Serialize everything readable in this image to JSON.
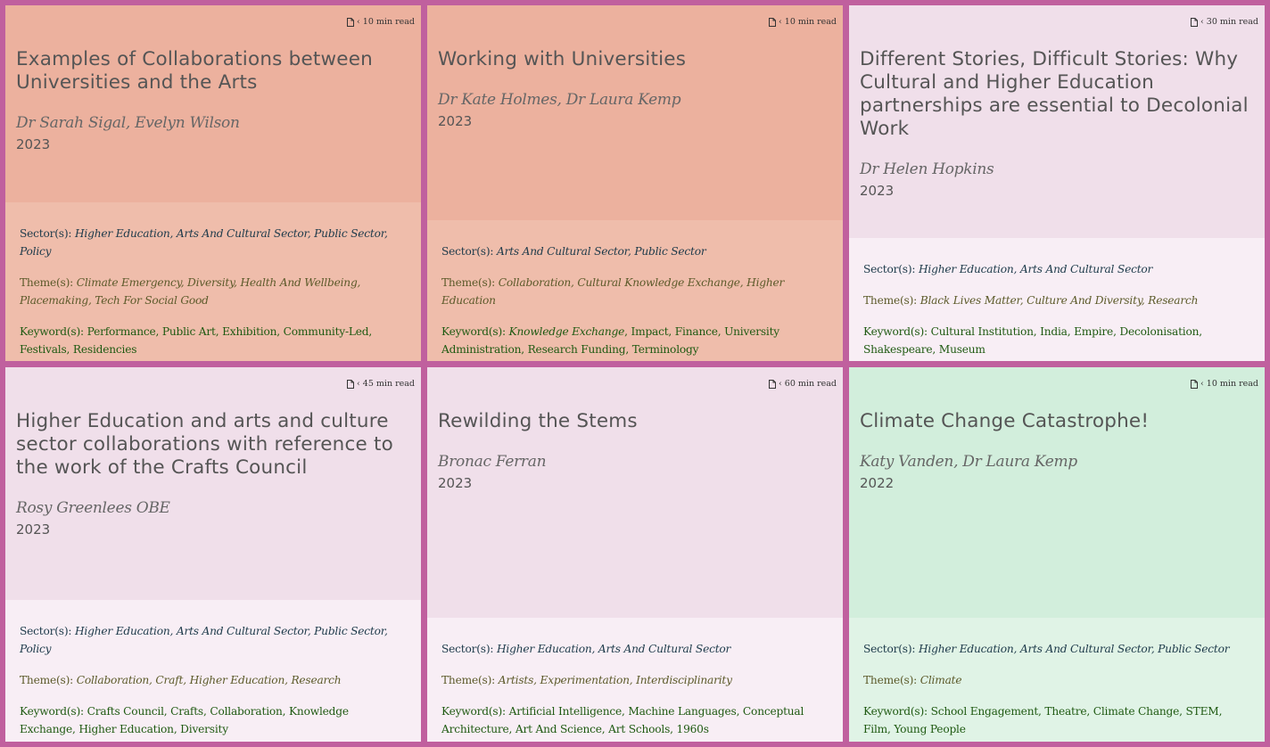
{
  "labels": {
    "sector": "Sector(s): ",
    "theme": "Theme(s): ",
    "keyword": "Keyword(s): "
  },
  "colors": {
    "frame": "#c0609e",
    "salmon_top": "#ecb19e",
    "salmon_bottom": "#efbdab",
    "lilac_top": "#f0dfea",
    "lilac_bottom": "#f8eef5",
    "mint_top": "#d2eedc",
    "mint_bottom": "#e0f3e6"
  },
  "cards": [
    {
      "read_time": "‹ 10 min read",
      "title": "Examples of Collaborations between Universities and the Arts",
      "authors": "Dr Sarah Sigal, Evelyn Wilson",
      "year": "2023",
      "sectors": "Higher Education, Arts And Cultural Sector, Public Sector, Policy",
      "themes": "Climate Emergency, Diversity, Health And Wellbeing, Placemaking, Tech For Social Good",
      "keywords": "Performance, Public Art, Exhibition, Community-Led, Festivals, Residencies"
    },
    {
      "read_time": "‹ 10 min read",
      "title": "Working with Universities",
      "authors": "Dr Kate Holmes, Dr Laura Kemp",
      "year": "2023",
      "sectors": "Arts And Cultural Sector, Public Sector",
      "themes": "Collaboration, Cultural Knowledge Exchange, Higher Education",
      "keywords_italic": "Knowledge Exchange",
      "keywords": ", Impact, Finance, University Administration, Research Funding, Terminology"
    },
    {
      "read_time": "‹ 30 min read",
      "title": "Different Stories, Difficult Stories: Why Cultural and Higher Education partnerships are essential to Decolonial Work",
      "authors": "Dr Helen Hopkins",
      "year": "2023",
      "sectors": "Higher Education, Arts And Cultural Sector",
      "themes": "Black Lives Matter, Culture And Diversity, Research",
      "keywords": "Cultural Institution, India, Empire, Decolonisation, Shakespeare, Museum"
    },
    {
      "read_time": "‹ 45 min read",
      "title": "Higher Education and arts and culture sector collaborations with reference to the work of the Crafts Council",
      "authors": "Rosy Greenlees OBE",
      "year": "2023",
      "sectors": "Higher Education, Arts And Cultural Sector, Public Sector, Policy",
      "themes": "Collaboration, Craft, Higher Education, Research",
      "keywords": "Crafts Council, Crafts, Collaboration, Knowledge Exchange, Higher Education, Diversity"
    },
    {
      "read_time": "‹ 60 min read",
      "title": "Rewilding the Stems",
      "authors": "Bronac Ferran",
      "year": "2023",
      "sectors": "Higher Education, Arts And Cultural Sector",
      "themes": "Artists, Experimentation, Interdisciplinarity",
      "keywords": "Artificial Intelligence, Machine Languages, Conceptual Architecture, Art And Science, Art Schools, 1960s"
    },
    {
      "read_time": "‹ 10 min read",
      "title": "Climate Change Catastrophe!",
      "authors": "Katy Vanden, Dr Laura Kemp",
      "year": "2022",
      "sectors": "Higher Education, Arts And Cultural Sector, Public Sector",
      "themes": "Climate",
      "keywords": "School Engagement, Theatre, Climate Change, STEM, Film, Young People"
    }
  ]
}
